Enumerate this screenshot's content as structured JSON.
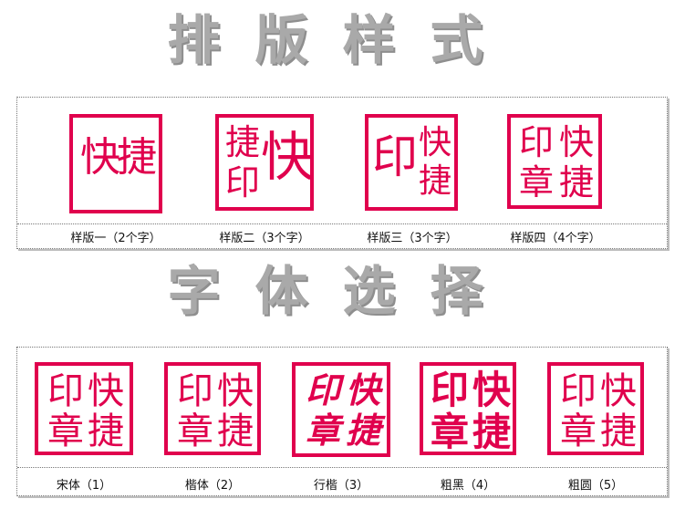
{
  "titles": {
    "layout": "排版样式",
    "font": "字体选择"
  },
  "layouts": [
    {
      "caption": "样版一（2个字）",
      "chars": [
        "快",
        "捷"
      ]
    },
    {
      "caption": "样版二（3个字）",
      "chars": [
        "捷",
        "印",
        "快"
      ]
    },
    {
      "caption": "样版三（3个字）",
      "chars": [
        "印",
        "快",
        "捷"
      ]
    },
    {
      "caption": "样版四（4个字）",
      "chars": [
        "印",
        "快",
        "章",
        "捷"
      ]
    }
  ],
  "fonts": [
    {
      "caption": "宋体（1）",
      "chars": [
        "印",
        "快",
        "章",
        "捷"
      ]
    },
    {
      "caption": "楷体（2）",
      "chars": [
        "印",
        "快",
        "章",
        "捷"
      ]
    },
    {
      "caption": "行楷（3）",
      "chars": [
        "印",
        "快",
        "章",
        "捷"
      ]
    },
    {
      "caption": "粗黑（4）",
      "chars": [
        "印",
        "快",
        "章",
        "捷"
      ]
    },
    {
      "caption": "粗圆（5）",
      "chars": [
        "印",
        "快",
        "章",
        "捷"
      ]
    }
  ],
  "colors": {
    "stamp": "#e0004d",
    "title": "#a9a9a9"
  }
}
